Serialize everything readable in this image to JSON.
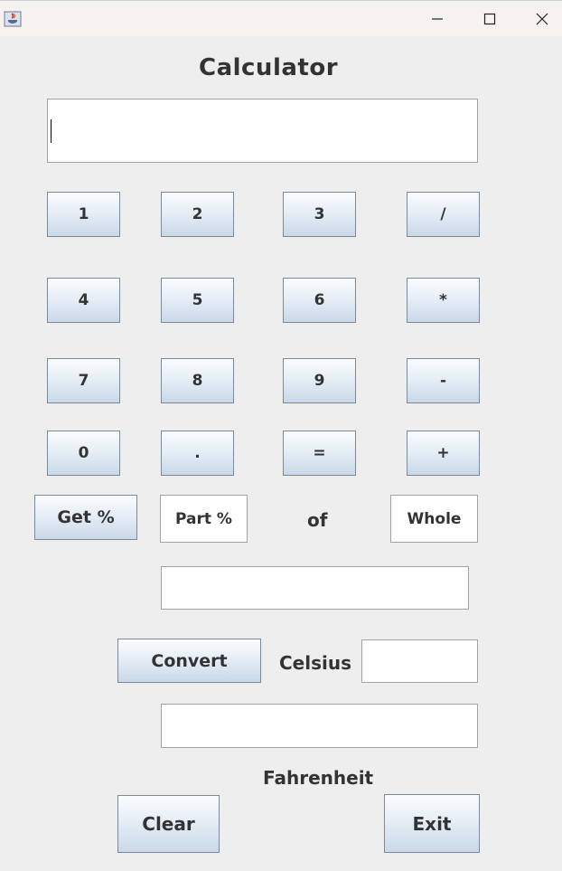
{
  "window": {
    "app_icon": "java-cup-icon",
    "controls": [
      "minimize-icon",
      "maximize-icon",
      "close-icon"
    ]
  },
  "calculator": {
    "title": "Calculator",
    "display_value": "",
    "keys": {
      "k1": "1",
      "k2": "2",
      "k3": "3",
      "div": "/",
      "k4": "4",
      "k5": "5",
      "k6": "6",
      "mul": "*",
      "k7": "7",
      "k8": "8",
      "k9": "9",
      "sub": "-",
      "k0": "0",
      "dot": ".",
      "eq": "=",
      "add": "+"
    }
  },
  "percent": {
    "get_label": "Get %",
    "part_label": "Part %",
    "of_label": "of",
    "whole_label": "Whole",
    "result_value": ""
  },
  "temperature": {
    "convert_label": "Convert",
    "celsius_label": "Celsius",
    "celsius_value": "",
    "fahrenheit_value": "",
    "fahrenheit_label": "Fahrenheit"
  },
  "actions": {
    "clear_label": "Clear",
    "exit_label": "Exit"
  }
}
